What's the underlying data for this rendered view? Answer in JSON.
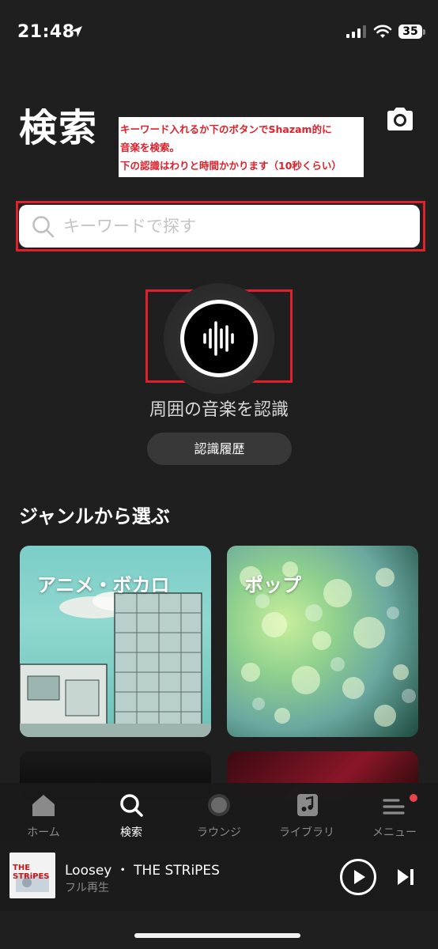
{
  "status_bar": {
    "time": "21:48",
    "battery": "35"
  },
  "header": {
    "title": "検索"
  },
  "annotation": {
    "lines": [
      "キーワード入れるか下のボタンでShazam的に",
      "音楽を検索。",
      "下の認識はわりと時間かかります（10秒くらい）"
    ]
  },
  "search": {
    "placeholder": "キーワードで探す",
    "value": ""
  },
  "recognize": {
    "label": "周囲の音楽を認識",
    "history_label": "認識履歴"
  },
  "genres": {
    "title": "ジャンルから選ぶ",
    "items": [
      {
        "label": "アニメ・ボカロ"
      },
      {
        "label": "ポップ"
      }
    ]
  },
  "tabs": [
    {
      "label": "ホーム",
      "icon": "home-icon"
    },
    {
      "label": "検索",
      "icon": "search-icon",
      "active": true
    },
    {
      "label": "ラウンジ",
      "icon": "lounge-icon"
    },
    {
      "label": "ライブラリ",
      "icon": "library-icon"
    },
    {
      "label": "メニュー",
      "icon": "menu-icon"
    }
  ],
  "player": {
    "title": "Loosey ・ THE STRiPES",
    "subtitle": "フル再生",
    "album_text": "THE STRiPES"
  },
  "colors": {
    "highlight": "#e0212b",
    "background": "#1f1f1f",
    "badge": "#e8434b"
  }
}
